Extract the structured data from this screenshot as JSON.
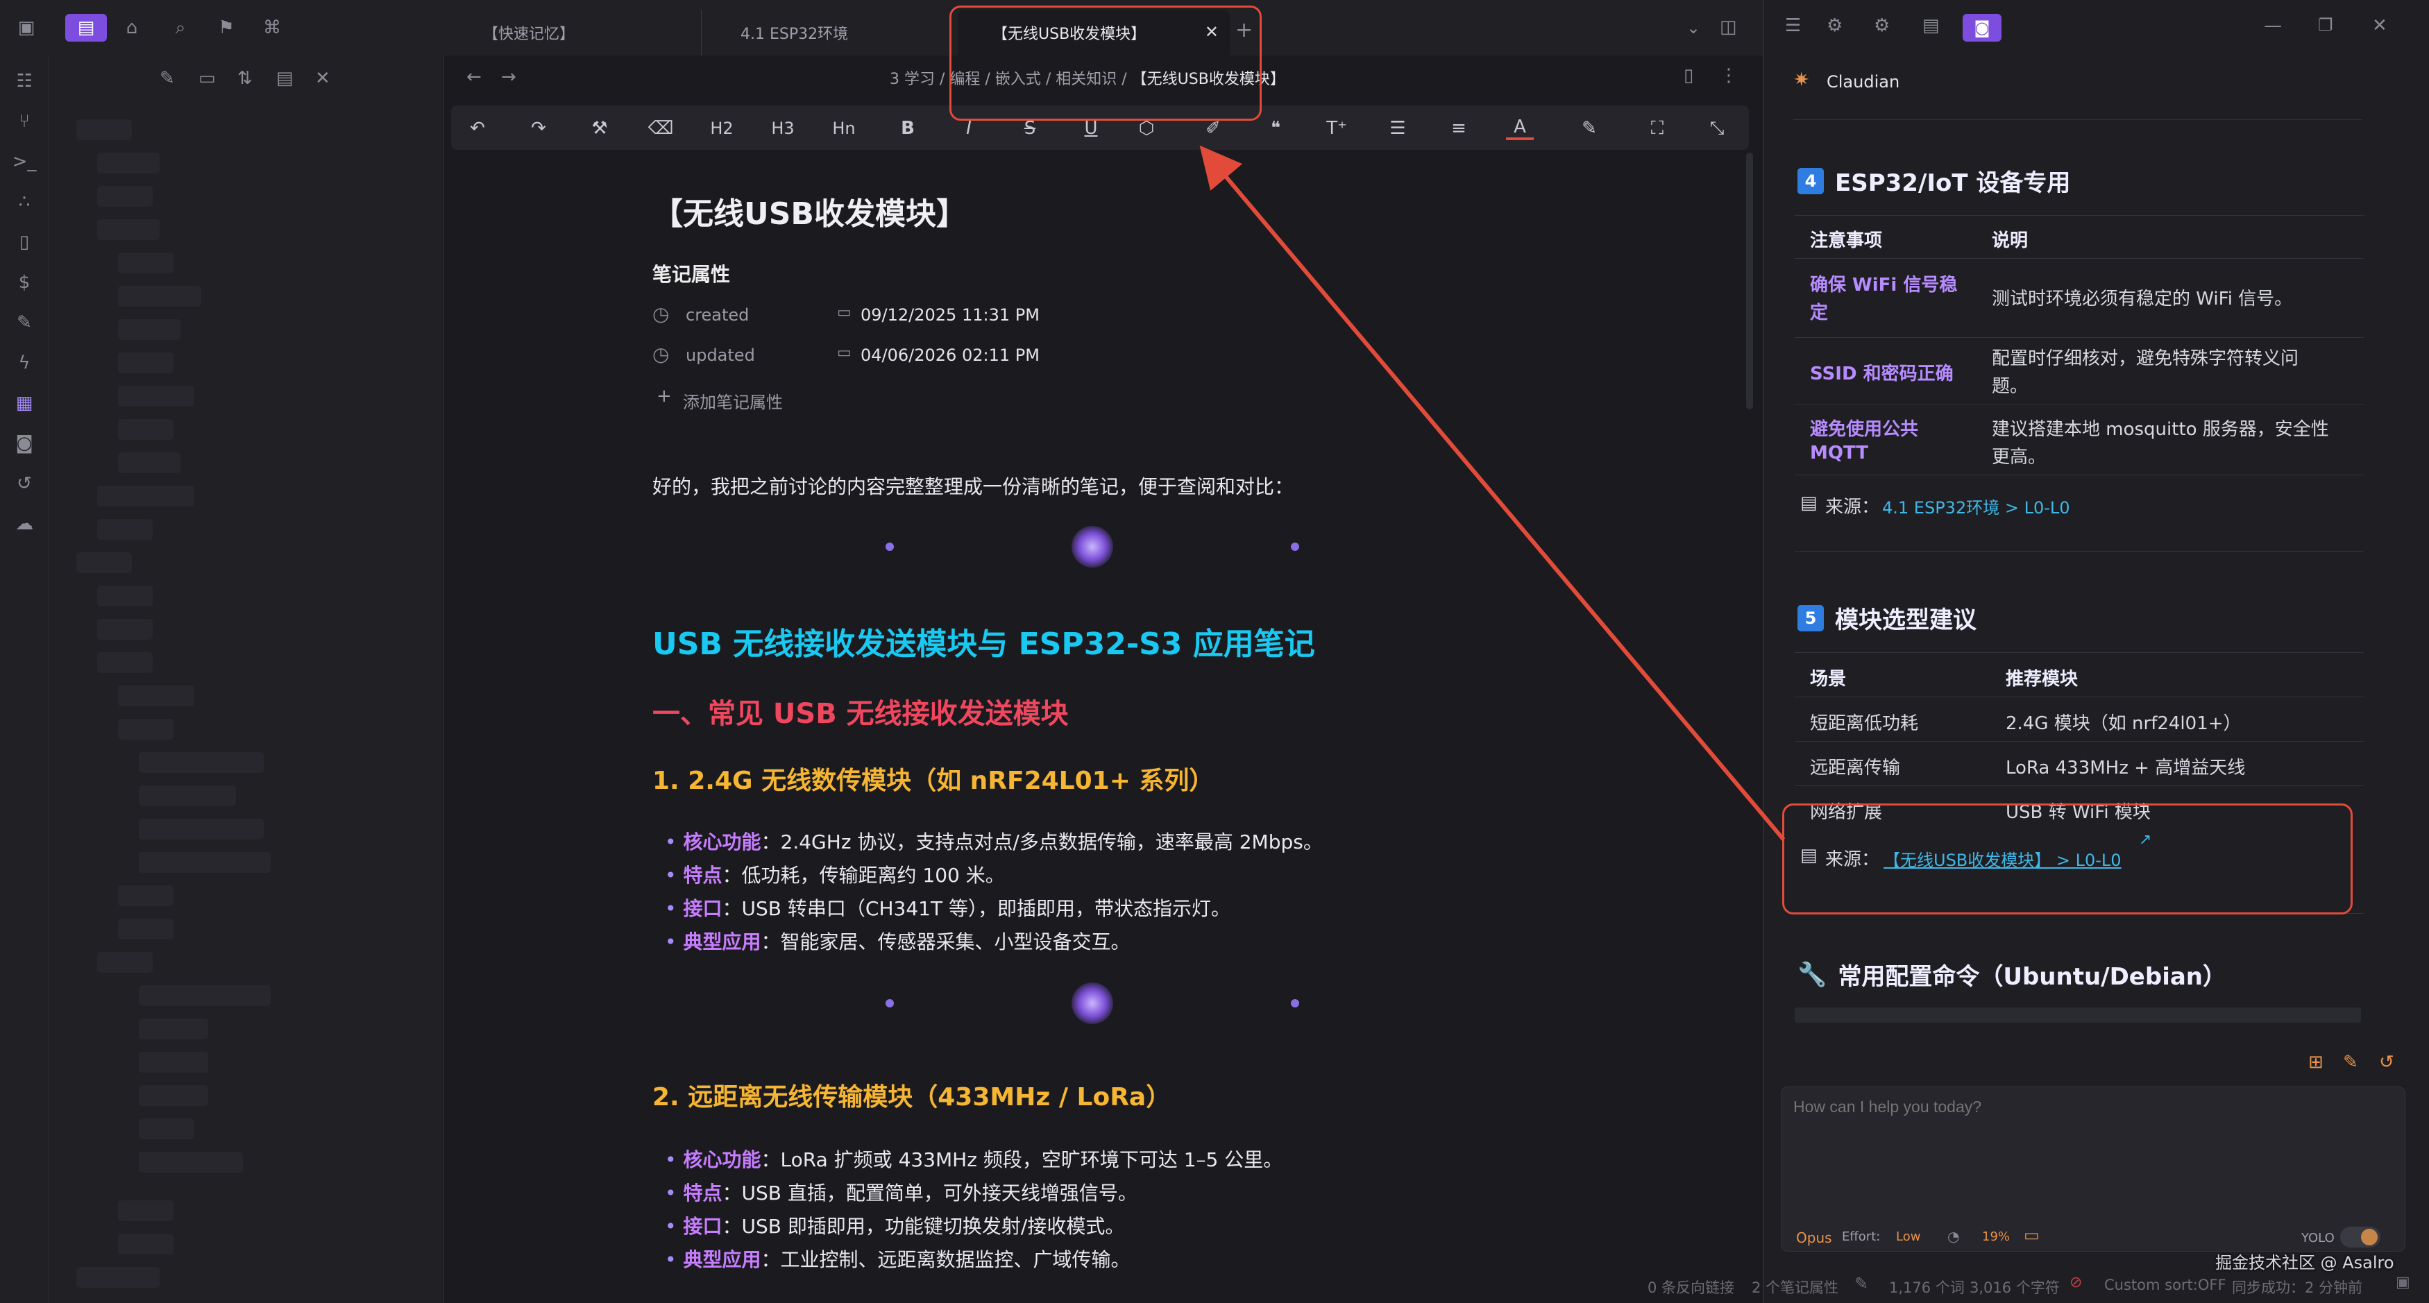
{
  "tabs": [
    {
      "label": "【快速记忆】"
    },
    {
      "label": "4.1 ESP32环境"
    },
    {
      "label": "【无线USB收发模块】"
    }
  ],
  "breadcrumb": [
    "3 学习",
    "编程",
    "嵌入式",
    "相关知识",
    "【无线USB收发模块】"
  ],
  "toolbar": {
    "h2": "H2",
    "h3": "H3",
    "hn": "Hn",
    "bold": "B",
    "italic": "I",
    "strike": "S",
    "underline": "U",
    "color": "A"
  },
  "note": {
    "title": "【无线USB收发模块】",
    "props_title": "笔记属性",
    "created_label": "created",
    "created_value": "09/12/2025 11:31 PM",
    "updated_label": "updated",
    "updated_value": "04/06/2026 02:11 PM",
    "add_prop": "添加笔记属性",
    "intro": "好的，我把之前讨论的内容完整整理成一份清晰的笔记，便于查阅和对比：",
    "h1": "USB 无线接收发送模块与 ESP32-S3 应用笔记",
    "h2": "一、常见 USB 无线接收发送模块",
    "s1": {
      "title": "1. 2.4G 无线数传模块（如 nRF24L01+ 系列）",
      "items": [
        {
          "k": "核心功能",
          "v": "：2.4GHz 协议，支持点对点/多点数据传输，速率最高 2Mbps。"
        },
        {
          "k": "特点",
          "v": "：低功耗，传输距离约 100 米。"
        },
        {
          "k": "接口",
          "v": "：USB 转串口（CH341T 等），即插即用，带状态指示灯。"
        },
        {
          "k": "典型应用",
          "v": "：智能家居、传感器采集、小型设备交互。"
        }
      ]
    },
    "s2": {
      "title": "2. 远距离无线传输模块（433MHz / LoRa）",
      "items": [
        {
          "k": "核心功能",
          "v": "：LoRa 扩频或 433MHz 频段，空旷环境下可达 1–5 公里。"
        },
        {
          "k": "特点",
          "v": "：USB 直插，配置简单，可外接天线增强信号。"
        },
        {
          "k": "接口",
          "v": "：USB 即插即用，功能键切换发射/接收模式。"
        },
        {
          "k": "典型应用",
          "v": "：工业控制、远距离数据监控、广域传输。"
        }
      ]
    }
  },
  "right": {
    "app_name": "Claudian",
    "s4_num": "4",
    "s4_title": "ESP32/IoT 设备专用",
    "s4_head": [
      "注意事项",
      "说明"
    ],
    "s4_rows": [
      {
        "a1": "确保 WiFi 信号稳",
        "a2": "定",
        "b1": "测试时环境必须有稳定的 WiFi 信号。",
        "b2": ""
      },
      {
        "a1": "SSID 和密码正确",
        "a2": "",
        "b1": "配置时仔细核对，避免特殊字符转义问",
        "b2": "题。"
      },
      {
        "a1": "避免使用公共",
        "a2": "MQTT",
        "b1": "建议搭建本地 mosquitto 服务器，安全性",
        "b2": "更高。"
      }
    ],
    "src_label": "来源：",
    "s4_src": "4.1 ESP32环境 > L0-L0",
    "s5_num": "5",
    "s5_title": "模块选型建议",
    "s5_head": [
      "场景",
      "推荐模块"
    ],
    "s5_rows": [
      {
        "a": "短距离低功耗",
        "b": "2.4G 模块（如 nrf24l01+）"
      },
      {
        "a": "远距离传输",
        "b": "LoRa 433MHz + 高增益天线"
      },
      {
        "a": "网络扩展",
        "b": "USB 转 WiFi 模块"
      }
    ],
    "s5_src": "【无线USB收发模块】 > L0-L0",
    "cmd_title": "常用配置命令（Ubuntu/Debian）",
    "input_placeholder": "How can I help you today?",
    "model": "Opus",
    "effort_label": "Effort:",
    "effort_value": "Low",
    "context_pct": "19%",
    "yolo": "YOLO"
  },
  "status": {
    "backlinks": "0 条反向链接",
    "props": "2 个笔记属性",
    "words": "1,176 个词",
    "chars": "3,016 个字符",
    "sort": "Custom sort:OFF",
    "sync": "同步成功：2 分钟前",
    "watermark": "掘金技术社区 @ Asalro"
  },
  "colors": {
    "accent": "#a78bfa",
    "h1": "#19c9f2",
    "h2": "#f0475f",
    "h3": "#f6b532",
    "annotation": "#e24b3a"
  }
}
